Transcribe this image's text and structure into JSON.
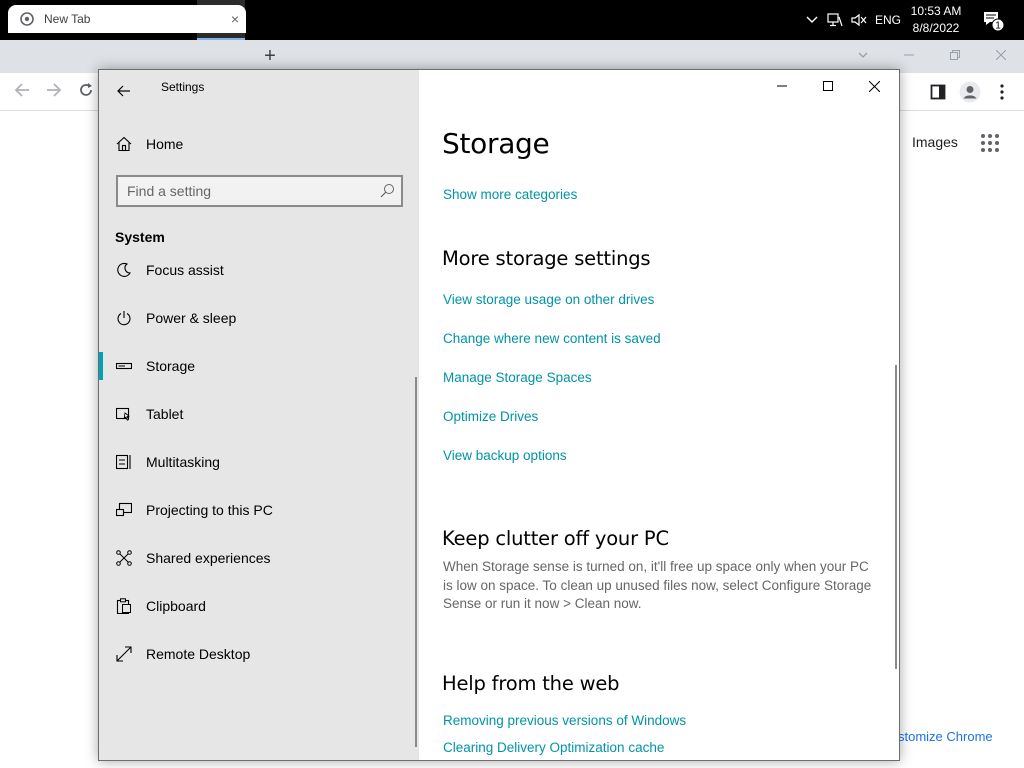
{
  "taskbar": {
    "tray": {
      "language": "ENG"
    },
    "clock": {
      "time": "10:53 AM",
      "date": "8/8/2022"
    },
    "notification_count": "1"
  },
  "chrome": {
    "tab_title": "New Tab",
    "tab_close": "×",
    "new_tab": "+",
    "images_link": "Images",
    "customize_text": "stomize Chrome"
  },
  "settings": {
    "title": "Settings",
    "home": "Home",
    "search_placeholder": "Find a setting",
    "section": "System",
    "nav_items": [
      {
        "label": "Focus assist",
        "icon": "focus-assist-icon"
      },
      {
        "label": "Power & sleep",
        "icon": "power-icon"
      },
      {
        "label": "Storage",
        "icon": "storage-icon",
        "selected": true
      },
      {
        "label": "Tablet",
        "icon": "tablet-icon"
      },
      {
        "label": "Multitasking",
        "icon": "multitasking-icon"
      },
      {
        "label": "Projecting to this PC",
        "icon": "projecting-icon"
      },
      {
        "label": "Shared experiences",
        "icon": "shared-experiences-icon"
      },
      {
        "label": "Clipboard",
        "icon": "clipboard-icon"
      },
      {
        "label": "Remote Desktop",
        "icon": "remote-desktop-icon"
      }
    ],
    "content": {
      "title": "Storage",
      "show_more": "Show more categories",
      "more_storage": {
        "heading": "More storage settings",
        "links": [
          "View storage usage on other drives",
          "Change where new content is saved",
          "Manage Storage Spaces",
          "Optimize Drives",
          "View backup options"
        ]
      },
      "keep_clutter": {
        "heading": "Keep clutter off your PC",
        "text": "When Storage sense is turned on, it'll free up space only when your PC is low on space. To clean up unused files now, select Configure Storage Sense or run it now > Clean now."
      },
      "help": {
        "heading": "Help from the web",
        "links": [
          "Removing previous versions of Windows",
          "Clearing Delivery Optimization cache"
        ]
      }
    }
  },
  "colors": {
    "accent": "#00a2b8",
    "link": "#0094a6",
    "sidebar_bg": "#e6e6e6",
    "taskbar_bg": "#000000"
  }
}
